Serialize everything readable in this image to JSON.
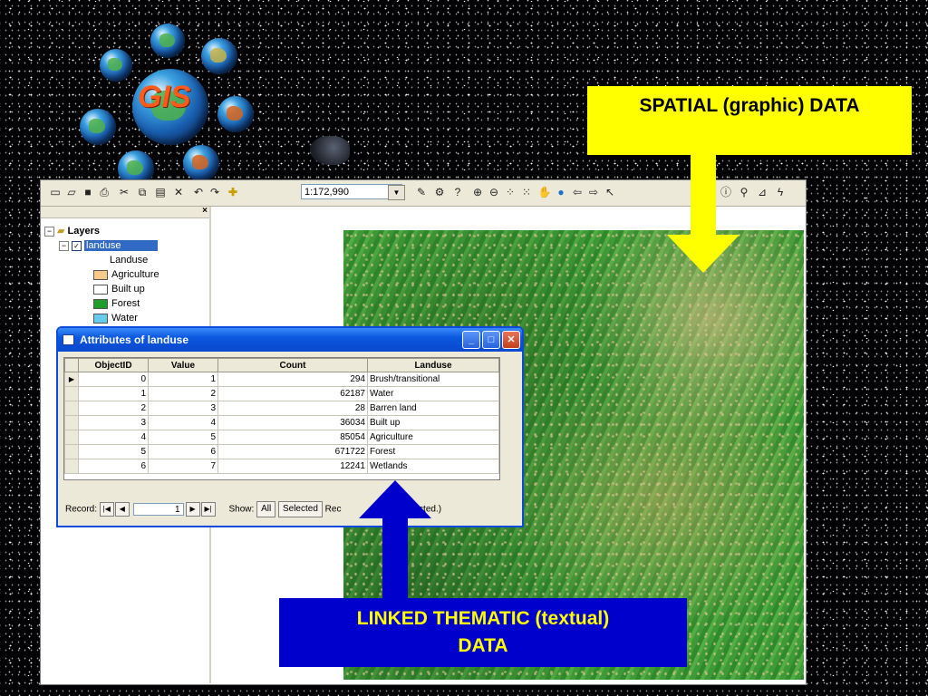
{
  "logo": {
    "text": "GIS"
  },
  "toolbar": {
    "scale_value": "1:172,990",
    "icons": [
      "new-document-icon",
      "open-folder-icon",
      "save-icon",
      "print-icon",
      "cut-icon",
      "copy-icon",
      "paste-icon",
      "delete-icon",
      "undo-icon",
      "redo-icon",
      "add-data-icon",
      "editor-icon",
      "arctoolbox-icon",
      "whats-this-icon",
      "zoom-in-icon",
      "zoom-out-icon",
      "fixed-zoom-in-icon",
      "fixed-zoom-out-icon",
      "pan-icon",
      "full-extent-icon",
      "back-icon",
      "forward-icon",
      "select-icon",
      "identify-icon",
      "find-icon",
      "measure-icon",
      "hyperlink-icon"
    ]
  },
  "toc": {
    "root_label": "Layers",
    "layer_label": "landuse",
    "field_label": "Landuse",
    "legend": [
      {
        "label": "Agriculture",
        "color": "#f4c98a"
      },
      {
        "label": "Built up",
        "color": "#ffffff"
      },
      {
        "label": "Forest",
        "color": "#1f9e2c"
      },
      {
        "label": "Water",
        "color": "#66ccee"
      }
    ]
  },
  "attributes": {
    "title": "Attributes of landuse",
    "columns": [
      "ObjectID",
      "Value",
      "Count",
      "Landuse"
    ],
    "rows": [
      {
        "objectid": "0",
        "value": "1",
        "count": "294",
        "landuse": "Brush/transitional"
      },
      {
        "objectid": "1",
        "value": "2",
        "count": "62187",
        "landuse": "Water"
      },
      {
        "objectid": "2",
        "value": "3",
        "count": "28",
        "landuse": "Barren land"
      },
      {
        "objectid": "3",
        "value": "4",
        "count": "36034",
        "landuse": "Built up"
      },
      {
        "objectid": "4",
        "value": "5",
        "count": "85054",
        "landuse": "Agriculture"
      },
      {
        "objectid": "5",
        "value": "6",
        "count": "671722",
        "landuse": "Forest"
      },
      {
        "objectid": "6",
        "value": "7",
        "count": "12241",
        "landuse": "Wetlands"
      }
    ],
    "footer": {
      "record_label": "Record:",
      "record_value": "1",
      "show_label": "Show:",
      "all_label": "All",
      "selected_label": "Selected",
      "records_prefix": "Rec",
      "records_suffix": "Selected.)"
    },
    "window_buttons": {
      "minimize": "_",
      "maximize": "□",
      "close": "✕"
    }
  },
  "callouts": {
    "spatial": "SPATIAL (graphic) DATA",
    "thematic_line1": "LINKED THEMATIC (textual)",
    "thematic_line2": "DATA",
    "spatial_color": "#ffff00",
    "thematic_color": "#0000cc"
  }
}
